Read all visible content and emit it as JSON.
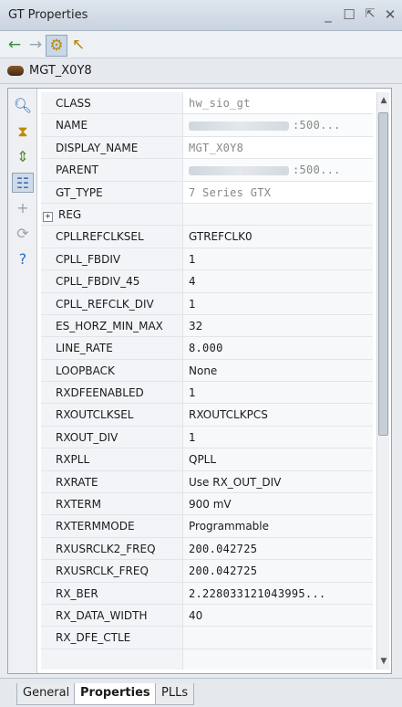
{
  "window": {
    "title": "GT Properties"
  },
  "window_controls": [
    "minimize",
    "restore",
    "float",
    "close"
  ],
  "object": {
    "name": "MGT_X0Y8"
  },
  "properties": [
    {
      "name": "CLASS",
      "value": "hw_sio_gt",
      "mono": true,
      "readonly": true
    },
    {
      "name": "NAME",
      "value": ":500...",
      "mono": true,
      "readonly": true,
      "redacted": true
    },
    {
      "name": "DISPLAY_NAME",
      "value": "MGT_X0Y8",
      "mono": true,
      "readonly": true
    },
    {
      "name": "PARENT",
      "value": ":500...",
      "mono": true,
      "readonly": true,
      "redacted": true
    },
    {
      "name": "GT_TYPE",
      "value": "7 Series GTX",
      "mono": true,
      "readonly": true
    },
    {
      "name": "REG",
      "value": "",
      "expandable": true,
      "expander": "+"
    },
    {
      "name": "CPLLREFCLKSEL",
      "value": "GTREFCLK0"
    },
    {
      "name": "CPLL_FBDIV",
      "value": "1"
    },
    {
      "name": "CPLL_FBDIV_45",
      "value": "4"
    },
    {
      "name": "CPLL_REFCLK_DIV",
      "value": "1"
    },
    {
      "name": "ES_HORZ_MIN_MAX",
      "value": "32"
    },
    {
      "name": "LINE_RATE",
      "value": "8.000",
      "mono": true
    },
    {
      "name": "LOOPBACK",
      "value": "None"
    },
    {
      "name": "RXDFEENABLED",
      "value": "1"
    },
    {
      "name": "RXOUTCLKSEL",
      "value": "RXOUTCLKPCS"
    },
    {
      "name": "RXOUT_DIV",
      "value": "1"
    },
    {
      "name": "RXPLL",
      "value": "QPLL"
    },
    {
      "name": "RXRATE",
      "value": "Use RX_OUT_DIV"
    },
    {
      "name": "RXTERM",
      "value": "900 mV"
    },
    {
      "name": "RXTERMMODE",
      "value": "Programmable"
    },
    {
      "name": "RXUSRCLK2_FREQ",
      "value": "200.042725",
      "mono": true
    },
    {
      "name": "RXUSRCLK_FREQ",
      "value": "200.042725",
      "mono": true
    },
    {
      "name": "RX_BER",
      "value": "2.228033121043995...",
      "mono": true
    },
    {
      "name": "RX_DATA_WIDTH",
      "value": "40"
    },
    {
      "name": "RX_DFE_CTLE",
      "value": ""
    },
    {
      "name": "",
      "value": ""
    }
  ],
  "tabs": [
    {
      "label": "General",
      "active": false
    },
    {
      "label": "Properties",
      "active": true
    },
    {
      "label": "PLLs",
      "active": false
    }
  ],
  "scrollbar": {
    "position_fraction": 0.0
  }
}
